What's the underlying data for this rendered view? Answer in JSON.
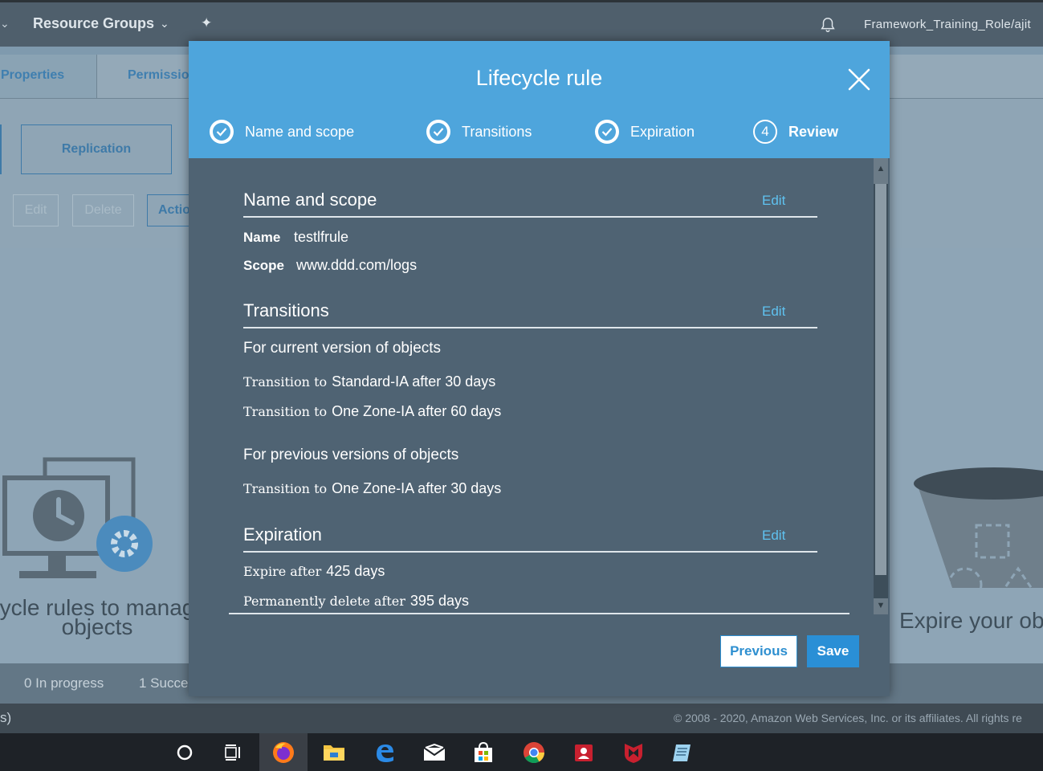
{
  "topbar": {
    "resource_groups": "Resource Groups",
    "account": "Framework_Training_Role/ajit"
  },
  "tabs": [
    {
      "label": "Properties"
    },
    {
      "label": "Permissio"
    }
  ],
  "background_buttons": {
    "replication": "Replication",
    "edit": "Edit",
    "delete": "Delete",
    "actions": "Actio"
  },
  "illustrations": {
    "left_text_line1": "ycle rules to manag",
    "left_text_line2": "objects",
    "right_text": "Expire your obj"
  },
  "status": {
    "in_progress": "0 In progress",
    "success": "1 Succe"
  },
  "footer": {
    "left": "s)",
    "copyright": "© 2008 - 2020, Amazon Web Services, Inc. or its affiliates. All rights re"
  },
  "modal": {
    "title": "Lifecycle rule",
    "steps": [
      {
        "label": "Name and scope",
        "state": "done"
      },
      {
        "label": "Transitions",
        "state": "done"
      },
      {
        "label": "Expiration",
        "state": "done"
      },
      {
        "label": "Review",
        "state": "current",
        "number": "4"
      }
    ],
    "name_scope": {
      "title": "Name and scope",
      "edit": "Edit",
      "name_label": "Name",
      "name_value": "testlfrule",
      "scope_label": "Scope",
      "scope_value": "www.ddd.com/logs"
    },
    "transitions": {
      "title": "Transitions",
      "edit": "Edit",
      "current_heading": "For current version of objects",
      "current_rows": [
        {
          "prefix": "Transition to",
          "value": "Standard-IA after 30 days"
        },
        {
          "prefix": "Transition to",
          "value": "One Zone-IA after 60 days"
        }
      ],
      "previous_heading": "For previous versions of objects",
      "previous_rows": [
        {
          "prefix": "Transition to",
          "value": "One Zone-IA after 30 days"
        }
      ]
    },
    "expiration": {
      "title": "Expiration",
      "edit": "Edit",
      "rows": [
        {
          "prefix": "Expire after",
          "value": "425 days"
        },
        {
          "prefix": "Permanently delete after",
          "value": "395 days"
        }
      ]
    },
    "buttons": {
      "previous": "Previous",
      "save": "Save"
    }
  },
  "colors": {
    "modal_header": "#4ea5dc",
    "modal_body": "#4f6373",
    "link": "#5fc2f0",
    "primary_button": "#2a8fd6"
  }
}
